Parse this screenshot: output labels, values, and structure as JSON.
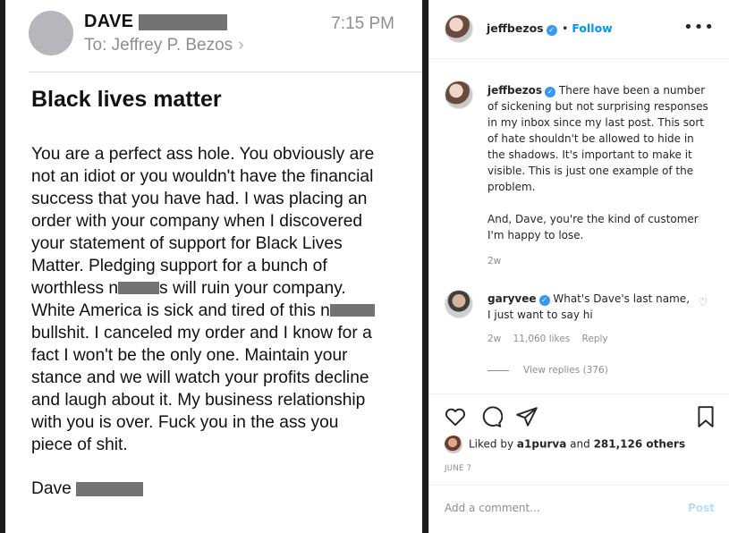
{
  "email": {
    "sender": "DAVE",
    "to_label": "To:",
    "recipient": "Jeffrey P. Bezos",
    "time": "7:15 PM",
    "subject": "Black lives matter",
    "body_line1": "You are a perfect ass hole. You obviously are",
    "body_line2": "not an idiot or you wouldn't have the financial",
    "body_line3": "success that you have had. I was placing an",
    "body_line4": "order with your company when I discovered",
    "body_line5": "your statement of support for Black Lives",
    "body_line6": "Matter. Pledging support for a bunch of",
    "body_line7a": "worthless n",
    "body_line7b": "s will ruin your company.",
    "body_line8": "White America is sick and tired of this n",
    "body_line9": "bullshit. I canceled my order and I know for a",
    "body_line10": "fact I won't be the only one. Maintain your",
    "body_line11": "stance and we will watch your profits decline",
    "body_line12": "and laugh about it. My business relationship",
    "body_line13": "with you is over. Fuck you in the ass you",
    "body_line14": "piece of shit.",
    "signature": "Dave"
  },
  "instagram": {
    "username": "jeffbezos",
    "follow_label": "Follow",
    "more_icon": "more-options-icon",
    "caption_username": "jeffbezos",
    "caption_para1": "There have been a number of sickening but not surprising responses in my inbox since my last post. This sort of hate shouldn't be allowed to hide in the shadows. It's important to make it visible. This is just one example of the problem.",
    "caption_para2": "And, Dave, you're the kind of customer I'm happy to lose.",
    "caption_age": "2w",
    "comment": {
      "username": "garyvee",
      "text": "What's Dave's last name, I just want to say hi",
      "age": "2w",
      "likes": "11,060 likes",
      "reply_label": "Reply",
      "view_replies": "View replies (376)"
    },
    "liked_by_prefix": "Liked by",
    "liked_by_user": "a1purva",
    "liked_by_and": "and",
    "liked_by_count": "281,126 others",
    "date": "JUNE 7",
    "comment_placeholder": "Add a comment...",
    "post_label": "Post",
    "colors": {
      "link_blue": "#0095f6",
      "verified_blue": "#3897f0",
      "muted_gray": "#8e8e8e"
    }
  }
}
